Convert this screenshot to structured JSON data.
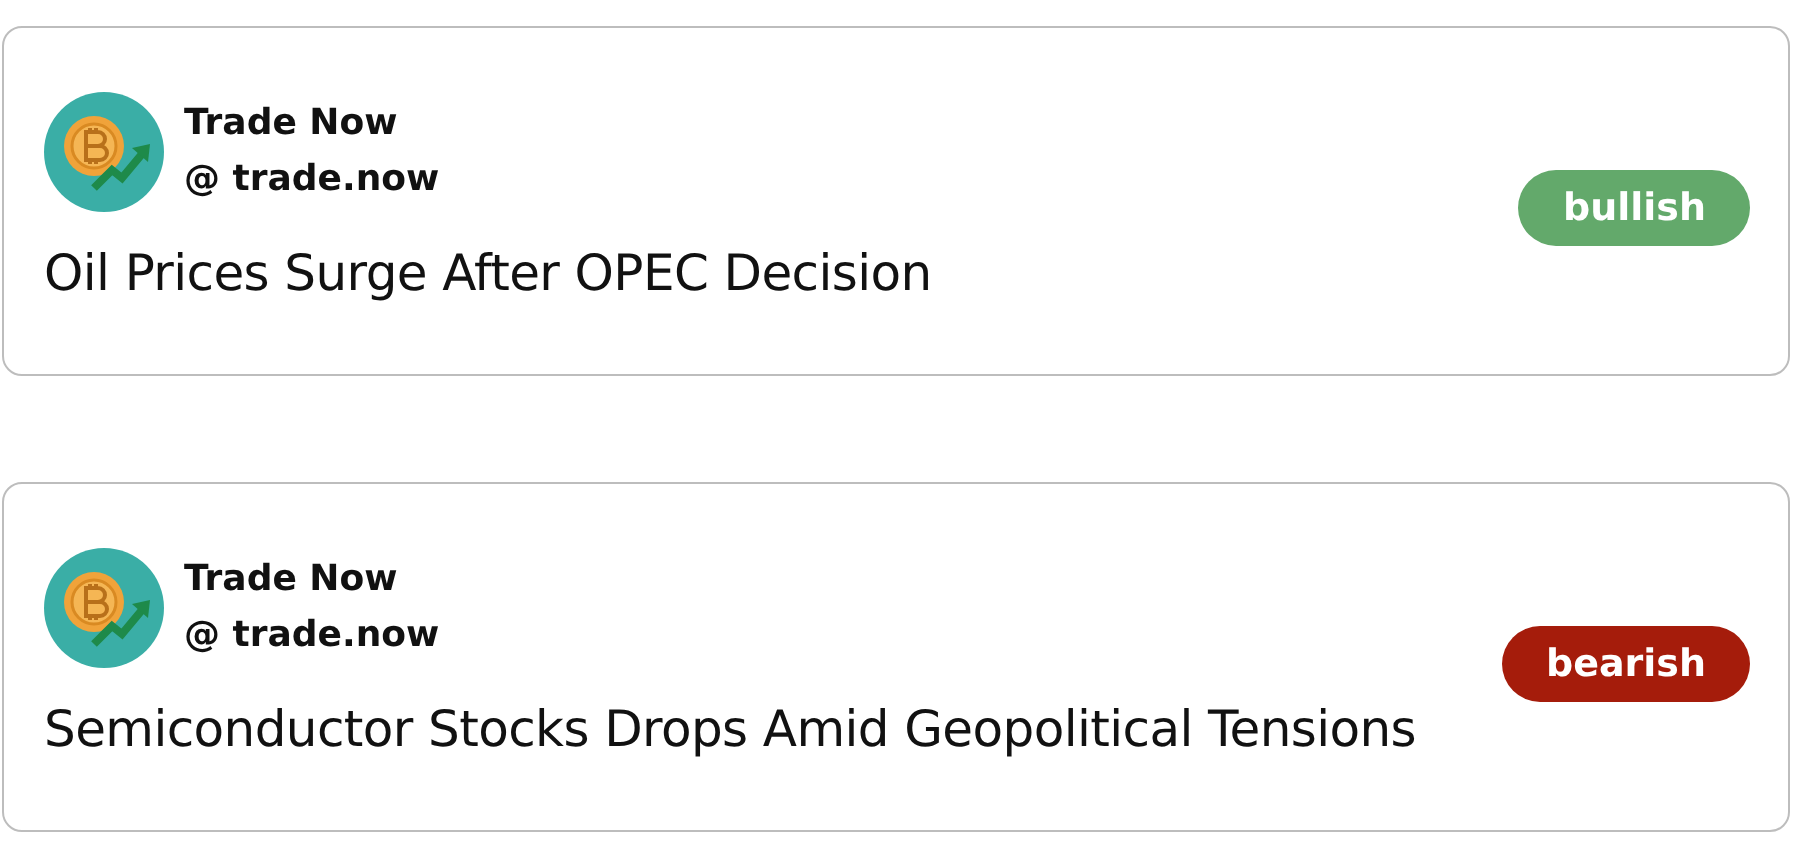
{
  "posts": [
    {
      "author": {
        "name": "Trade Now",
        "handle": "@ trade.now"
      },
      "headline": "Oil Prices Surge After OPEC Decision",
      "sentiment": {
        "label": "bullish",
        "color": "#63a96b"
      }
    },
    {
      "author": {
        "name": "Trade Now",
        "handle": "@ trade.now"
      },
      "headline": "Semiconductor Stocks Drops Amid Geopolitical Tensions",
      "sentiment": {
        "label": "bearish",
        "color": "#a51c0b"
      }
    }
  ]
}
